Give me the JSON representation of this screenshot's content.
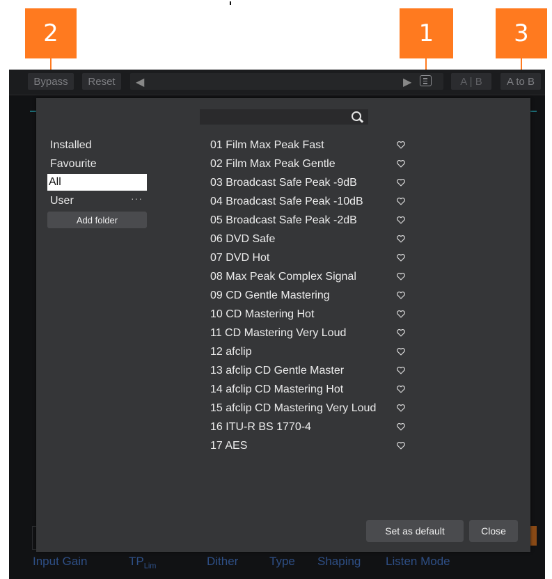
{
  "callouts": [
    {
      "label": "2"
    },
    {
      "label": "1"
    },
    {
      "label": "3"
    }
  ],
  "toolbar": {
    "bypass": "Bypass",
    "reset": "Reset",
    "prev_arrow": "◀",
    "next_arrow": "▶",
    "ab": "A | B",
    "a_to_b": "A to B"
  },
  "background_labels": {
    "input_gain": "Input Gain",
    "tp": "TP",
    "tp_sub": "Lim",
    "dither": "Dither",
    "type": "Type",
    "shaping": "Shaping",
    "listen_mode": "Listen Mode"
  },
  "preset_browser": {
    "search_value": "",
    "categories": [
      {
        "label": "Installed",
        "selected": false
      },
      {
        "label": "Favourite",
        "selected": false
      },
      {
        "label": "All",
        "selected": true
      },
      {
        "label": "User",
        "selected": false
      }
    ],
    "user_menu": "···",
    "add_folder": "Add folder",
    "presets": [
      "01 Film Max Peak Fast",
      "02 Film Max Peak Gentle",
      "03 Broadcast Safe Peak -9dB",
      "04 Broadcast Safe Peak -10dB",
      "05 Broadcast Safe Peak -2dB",
      "06 DVD Safe",
      "07 DVD Hot",
      "08 Max Peak Complex Signal",
      "09 CD Gentle Mastering",
      "10 CD Mastering Hot",
      "11 CD Mastering Very Loud",
      "12 afclip",
      "13 afclip CD Gentle Master",
      "14 afclip CD Mastering Hot",
      "15 afclip CD Mastering Very Loud",
      "16 ITU-R BS 1770-4",
      "17 AES"
    ],
    "set_default": "Set as default",
    "close": "Close"
  },
  "colors": {
    "callout": "#ff7a1f",
    "dialog_bg": "#353638",
    "plugin_bg": "#111214",
    "bg_label": "#2e4f86"
  }
}
